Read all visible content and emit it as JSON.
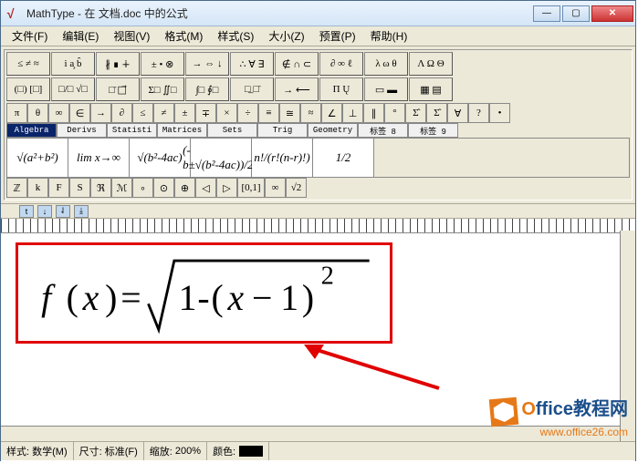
{
  "title": "MathType - 在 文档.doc 中的公式",
  "menu": {
    "file": "文件(F)",
    "edit": "编辑(E)",
    "view": "视图(V)",
    "format": "格式(M)",
    "style": "样式(S)",
    "size": "大小(Z)",
    "preset": "预置(P)",
    "help": "帮助(H)"
  },
  "palette_row1": [
    "≤ ≠ ≈",
    "i a̧ b̂",
    "∦ ∎ ∔",
    "± • ⊗",
    "→ ⇔ ↓",
    "∴ ∀ ∃",
    "∉ ∩ ⊂",
    "∂ ∞ ℓ",
    "λ ω θ",
    "Λ Ω Θ"
  ],
  "palette_row2": [
    "(□) [□]",
    "□/□ √□",
    "□̄ □⃗",
    "Σ□ ∬□",
    "∫□ ∮□",
    "□̲ □̄",
    "→ ⟵",
    "Π Ų",
    "▭ ▬",
    "▦ ▤"
  ],
  "palette_row3": [
    "π",
    "θ",
    "∞",
    "∈",
    "→",
    "∂",
    "≤",
    "≠",
    "±",
    "∓",
    "×",
    "÷",
    "≡",
    "≅",
    "≈",
    "∠",
    "⊥",
    "∥",
    "°",
    "Σ̂",
    "Σ̂",
    "∀",
    "?",
    "•"
  ],
  "tabs": [
    "Algebra",
    "Derivs",
    "Statisti",
    "Matrices",
    "Sets",
    "Trig",
    "Geometry",
    "标签 8",
    "标签 9"
  ],
  "templates": [
    "√(a²+b²)",
    "lim x→∞",
    "√(b²-4ac)",
    "(-b±√(b²-4ac))/2a",
    "n!/(r!(n-r)!)",
    "1/2"
  ],
  "greek_row": [
    "ℤ",
    "k",
    "F",
    "S",
    "ℜ",
    "ℳ",
    "∘",
    "⊙",
    "⊕",
    "◁",
    "▷",
    "[0,1]",
    "∞",
    "√2"
  ],
  "status": {
    "style_label": "样式:",
    "style_value": "数学(M)",
    "size_label": "尺寸:",
    "size_value": "标准(F)",
    "zoom_label": "缩放:",
    "zoom_value": "200%",
    "color_label": "颜色:"
  },
  "formula_display": "f(x)=√(1-(x-1)²)",
  "watermark": {
    "brand_o": "O",
    "brand_rest": "ffice教程网",
    "url": "www.office26.com"
  }
}
